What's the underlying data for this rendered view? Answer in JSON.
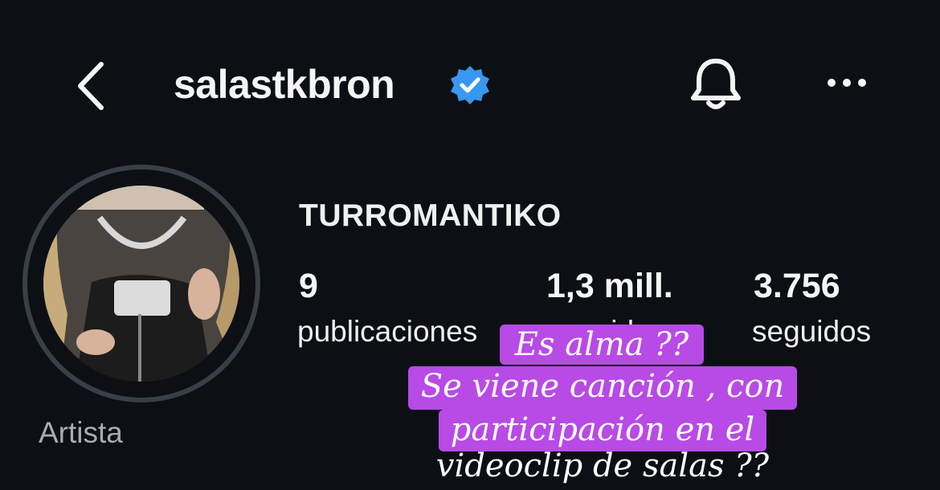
{
  "header": {
    "username": "salastkbron",
    "icons": {
      "back": "chevron-left-icon",
      "verified": "verified-badge-icon",
      "bell": "bell-icon",
      "more": "more-horizontal-icon"
    }
  },
  "profile": {
    "display_name": "TURROMANTIKO",
    "category": "Artista",
    "stats": [
      {
        "value": "9",
        "label": "publicaciones"
      },
      {
        "value": "1,3 mill.",
        "label": "seguidores"
      },
      {
        "value": "3.756",
        "label": "seguidos"
      }
    ]
  },
  "overlay_caption": {
    "lines": [
      "Es alma ??",
      "Se viene canción , con",
      "participación en el",
      "videoclip de salas ??"
    ],
    "color": "#b84ae6"
  },
  "colors": {
    "background": "#0c1015",
    "verified": "#3897f0",
    "muted": "#a8acb2"
  }
}
